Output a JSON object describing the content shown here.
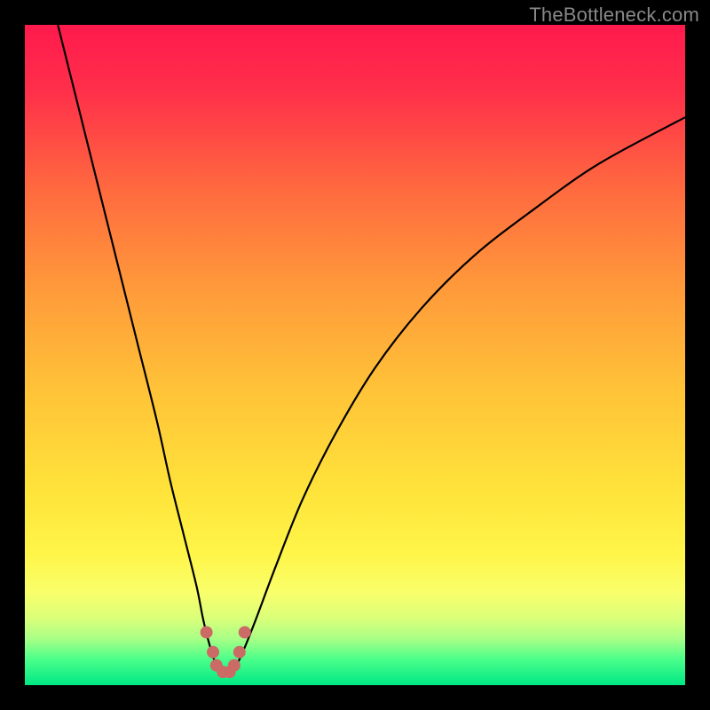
{
  "watermark": "TheBottleneck.com",
  "colors": {
    "gradient_stops": [
      {
        "offset": 0.0,
        "color": "#ff1a4d"
      },
      {
        "offset": 0.1,
        "color": "#ff2f4a"
      },
      {
        "offset": 0.25,
        "color": "#ff6a3f"
      },
      {
        "offset": 0.4,
        "color": "#ff9a3a"
      },
      {
        "offset": 0.55,
        "color": "#ffc238"
      },
      {
        "offset": 0.7,
        "color": "#ffe23a"
      },
      {
        "offset": 0.8,
        "color": "#fff548"
      },
      {
        "offset": 0.86,
        "color": "#f9ff6b"
      },
      {
        "offset": 0.9,
        "color": "#d9ff7a"
      },
      {
        "offset": 0.93,
        "color": "#a8ff86"
      },
      {
        "offset": 0.96,
        "color": "#4dff8a"
      },
      {
        "offset": 1.0,
        "color": "#00e884"
      }
    ],
    "curve": "#000000",
    "marker": "#cc6a66",
    "frame": "#000000"
  },
  "chart_data": {
    "type": "line",
    "title": "",
    "xlabel": "",
    "ylabel": "",
    "xlim": [
      0,
      100
    ],
    "ylim": [
      0,
      100
    ],
    "grid": false,
    "legend": false,
    "series": [
      {
        "name": "bottleneck-curve",
        "x": [
          5,
          8,
          11,
          14,
          17,
          20,
          22,
          24,
          26,
          27,
          28,
          29,
          30,
          31,
          32,
          33,
          35,
          38,
          42,
          47,
          53,
          60,
          68,
          77,
          87,
          100
        ],
        "y": [
          100,
          88,
          76,
          64,
          52,
          40,
          31,
          23,
          15,
          10,
          6,
          3,
          2,
          2,
          3,
          5,
          10,
          18,
          28,
          38,
          48,
          57,
          65,
          72,
          79,
          86
        ]
      }
    ],
    "markers": {
      "name": "minimum-markers",
      "x": [
        27.5,
        28.5,
        29.0,
        30.0,
        31.0,
        31.7,
        32.5,
        33.3
      ],
      "y": [
        8.0,
        5.0,
        3.0,
        2.0,
        2.0,
        3.0,
        5.0,
        8.0
      ]
    },
    "annotations": []
  }
}
